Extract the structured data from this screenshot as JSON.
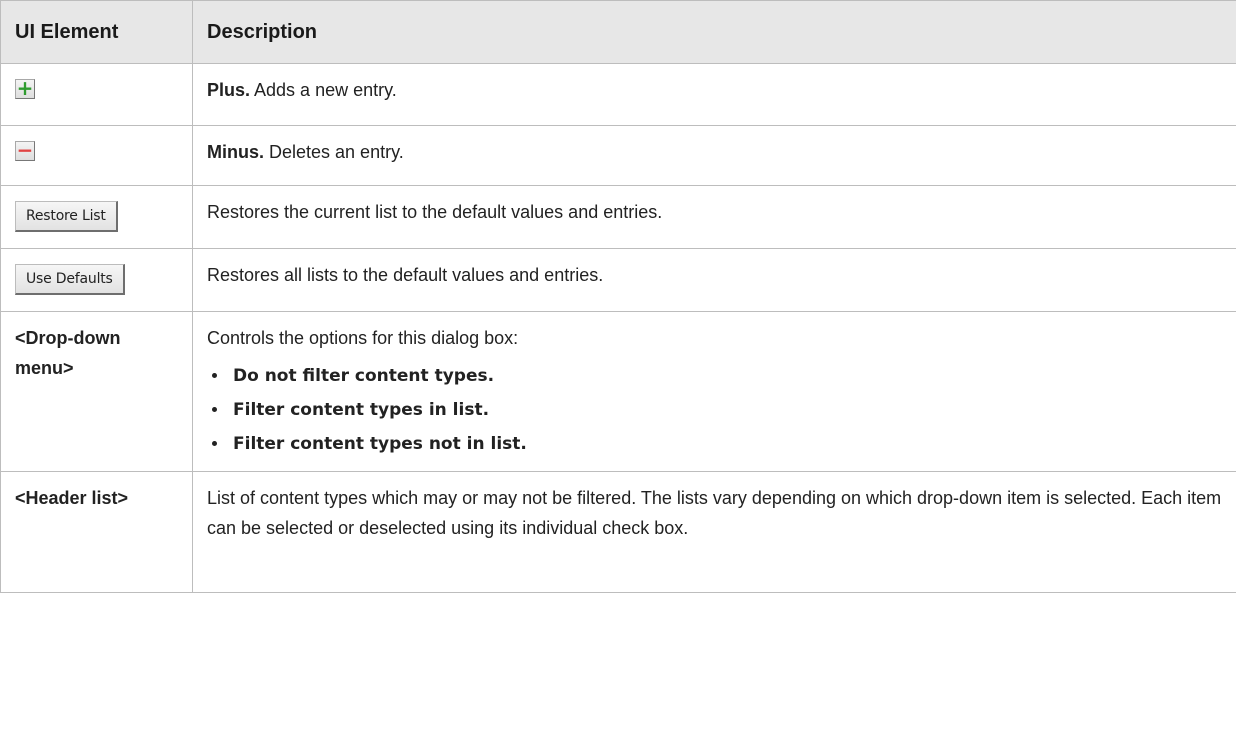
{
  "table": {
    "headers": {
      "element": "UI Element",
      "description": "Description"
    },
    "rows": [
      {
        "element_icon": "plus-icon",
        "element_glyph": "+",
        "desc_bold": "Plus.",
        "desc_text": " Adds a new entry."
      },
      {
        "element_icon": "minus-icon",
        "element_glyph": "−",
        "desc_bold": "Minus.",
        "desc_text": " Deletes an entry."
      },
      {
        "element_button": "Restore List",
        "desc_text": "Restores the current list to the default values and entries."
      },
      {
        "element_button": "Use Defaults",
        "desc_text": "Restores all lists to the default values and entries."
      },
      {
        "element_label": "<Drop-down menu>",
        "desc_text": "Controls the options for this dialog box:",
        "options": [
          "Do not filter content types.",
          "Filter content types in list.",
          "Filter content types not in list."
        ]
      },
      {
        "element_label": "<Header list>",
        "desc_text": "List of content types which may or may not be filtered. The lists vary depending on which drop-down item is selected. Each item can be selected or deselected using its individual check box."
      }
    ]
  }
}
